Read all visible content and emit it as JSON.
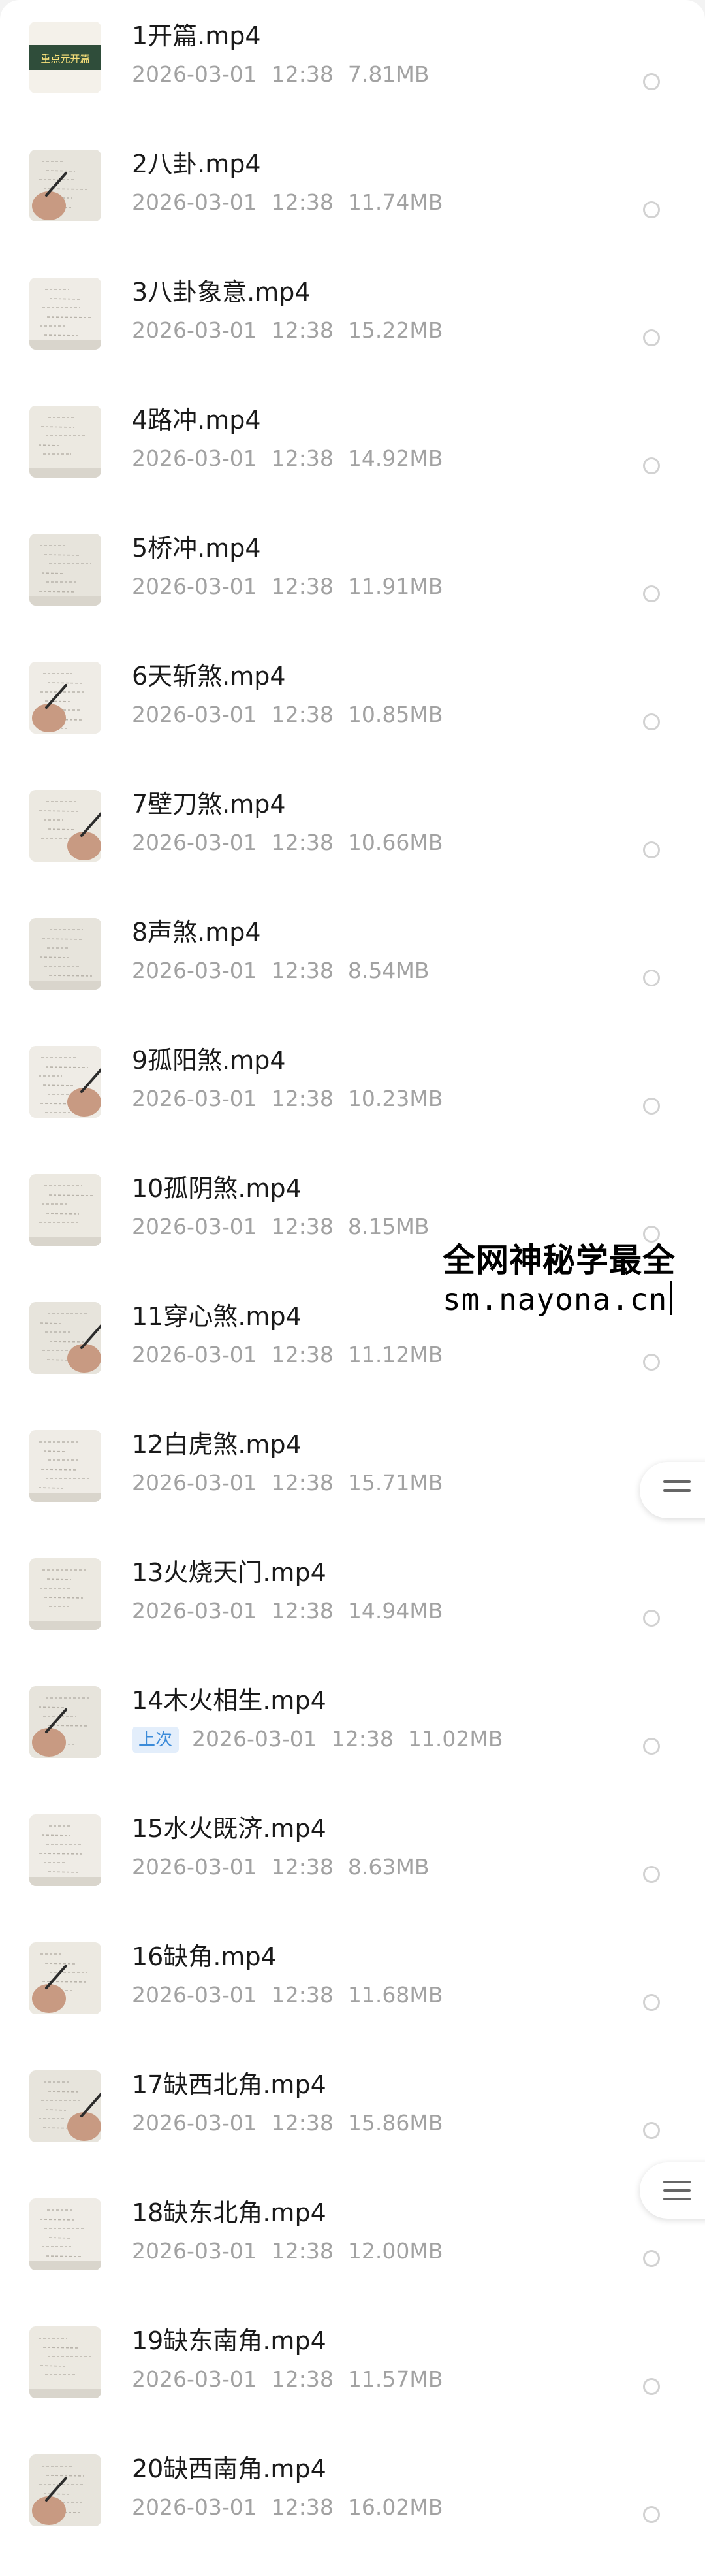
{
  "files": [
    {
      "name": "1开篇.mp4",
      "date": "2026-03-01",
      "time": "12:38",
      "size": "7.81MB",
      "thumb": "title-card"
    },
    {
      "name": "2八卦.mp4",
      "date": "2026-03-01",
      "time": "12:38",
      "size": "11.74MB",
      "thumb": "hand-writing"
    },
    {
      "name": "3八卦象意.mp4",
      "date": "2026-03-01",
      "time": "12:38",
      "size": "15.22MB",
      "thumb": "paper-notes"
    },
    {
      "name": "4路冲.mp4",
      "date": "2026-03-01",
      "time": "12:38",
      "size": "14.92MB",
      "thumb": "paper-notes"
    },
    {
      "name": "5桥冲.mp4",
      "date": "2026-03-01",
      "time": "12:38",
      "size": "11.91MB",
      "thumb": "paper-notes"
    },
    {
      "name": "6天斩煞.mp4",
      "date": "2026-03-01",
      "time": "12:38",
      "size": "10.85MB",
      "thumb": "hand-writing"
    },
    {
      "name": "7壁刀煞.mp4",
      "date": "2026-03-01",
      "time": "12:38",
      "size": "10.66MB",
      "thumb": "hand-writing"
    },
    {
      "name": "8声煞.mp4",
      "date": "2026-03-01",
      "time": "12:38",
      "size": "8.54MB",
      "thumb": "paper-notes"
    },
    {
      "name": "9孤阳煞.mp4",
      "date": "2026-03-01",
      "time": "12:38",
      "size": "10.23MB",
      "thumb": "hand-writing"
    },
    {
      "name": "10孤阴煞.mp4",
      "date": "2026-03-01",
      "time": "12:38",
      "size": "8.15MB",
      "thumb": "paper-notes"
    },
    {
      "name": "11穿心煞.mp4",
      "date": "2026-03-01",
      "time": "12:38",
      "size": "11.12MB",
      "thumb": "hand-writing"
    },
    {
      "name": "12白虎煞.mp4",
      "date": "2026-03-01",
      "time": "12:38",
      "size": "15.71MB",
      "thumb": "paper-notes"
    },
    {
      "name": "13火烧天门.mp4",
      "date": "2026-03-01",
      "time": "12:38",
      "size": "14.94MB",
      "thumb": "paper-notes"
    },
    {
      "name": "14木火相生.mp4",
      "date": "2026-03-01",
      "time": "12:38",
      "size": "11.02MB",
      "thumb": "hand-writing",
      "badge": "上次"
    },
    {
      "name": "15水火既济.mp4",
      "date": "2026-03-01",
      "time": "12:38",
      "size": "8.63MB",
      "thumb": "paper-notes"
    },
    {
      "name": "16缺角.mp4",
      "date": "2026-03-01",
      "time": "12:38",
      "size": "11.68MB",
      "thumb": "hand-writing"
    },
    {
      "name": "17缺西北角.mp4",
      "date": "2026-03-01",
      "time": "12:38",
      "size": "15.86MB",
      "thumb": "hand-writing"
    },
    {
      "name": "18缺东北角.mp4",
      "date": "2026-03-01",
      "time": "12:38",
      "size": "12.00MB",
      "thumb": "paper-notes"
    },
    {
      "name": "19缺东南角.mp4",
      "date": "2026-03-01",
      "time": "12:38",
      "size": "11.57MB",
      "thumb": "paper-notes"
    },
    {
      "name": "20缺西南角.mp4",
      "date": "2026-03-01",
      "time": "12:38",
      "size": "16.02MB",
      "thumb": "hand-writing"
    }
  ],
  "title_card_text": "重点元开篇",
  "watermark": {
    "line1": "全网神秘学最全",
    "line2": "sm.nayona.cn"
  },
  "floating_menu_icon": "menu-lines-icon",
  "colors": {
    "badge_text": "#3b8bd9",
    "badge_bg": "#e3eefb",
    "meta_text": "#a2a2a2"
  }
}
